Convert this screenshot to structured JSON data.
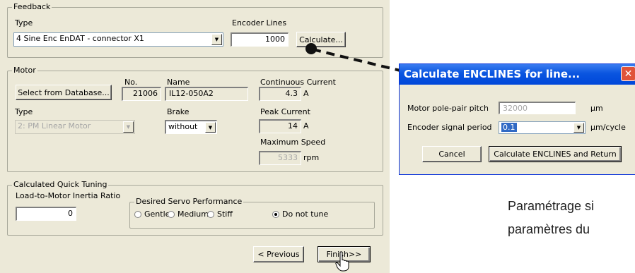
{
  "feedback": {
    "group_title": "Feedback",
    "type_label": "Type",
    "type_value": "4 Sine Enc EnDAT - connector X1",
    "encoder_lines_label": "Encoder Lines",
    "encoder_lines_value": "1000",
    "calculate_button": "Calculate..."
  },
  "motor": {
    "group_title": "Motor",
    "select_button": "Select from Database...",
    "no_label": "No.",
    "no_value": "21006",
    "name_label": "Name",
    "name_value": "IL12-050A2",
    "continuous_current_label": "Continuous Current",
    "continuous_current_value": "4.3",
    "continuous_current_unit": "A",
    "type_label": "Type",
    "type_value": "2: PM Linear Motor",
    "brake_label": "Brake",
    "brake_value": "without",
    "peak_current_label": "Peak Current",
    "peak_current_value": "14",
    "peak_current_unit": "A",
    "max_speed_label": "Maximum Speed",
    "max_speed_value": "5333",
    "max_speed_unit": "rpm"
  },
  "tuning": {
    "group_title": "Calculated Quick Tuning",
    "inertia_label": "Load-to-Motor Inertia Ratio",
    "inertia_value": "0",
    "servo_group_title": "Desired Servo Performance",
    "options": [
      "Gentle",
      "Medium",
      "Stiff",
      "Do not tune"
    ],
    "selected": "Do not tune"
  },
  "nav": {
    "previous_button": "< Previous",
    "finish_button": "Finish>>"
  },
  "popup": {
    "title": "Calculate ENCLINES for line...",
    "pole_pitch_label": "Motor pole-pair pitch",
    "pole_pitch_value": "32000",
    "pole_pitch_unit": "µm",
    "signal_period_label": "Encoder signal period",
    "signal_period_value": "0.1",
    "signal_period_unit": "µm/cycle",
    "cancel_button": "Cancel",
    "calculate_return_button": "Calculate ENCLINES and Return"
  },
  "caption": {
    "line1": "Paramétrage si",
    "line2": "paramètres du"
  },
  "colors": {
    "dialog_bg": "#ece9d8",
    "title_bar": "#0a55e0",
    "close_button": "#e0533a"
  }
}
